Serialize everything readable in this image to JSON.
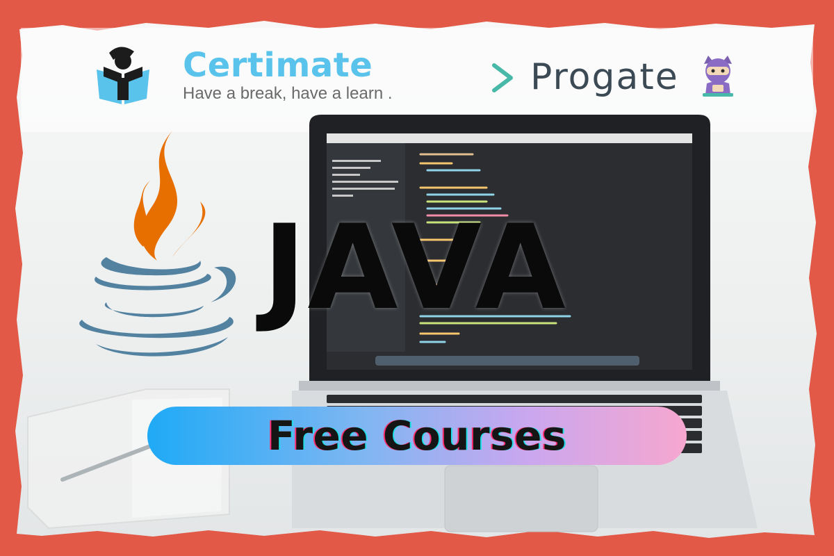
{
  "certimate": {
    "name": "Certimate",
    "tagline": "Have a break, have a learn ."
  },
  "progate": {
    "name": "Progate",
    "chevron": ">"
  },
  "headline": "JAVA",
  "cta": "Free Courses",
  "icons": [
    "certimate-reader-icon",
    "progate-chevron-icon",
    "progate-ninja-cat-icon",
    "java-coffee-cup-icon"
  ],
  "colors": {
    "border": "#e25a47",
    "certimate_blue": "#59c3ec",
    "java_orange": "#e76f00",
    "java_blue": "#5382a1",
    "progate_teal": "#48b8a8",
    "pill_start": "#1faaf6",
    "pill_end": "#f6a7cf"
  }
}
